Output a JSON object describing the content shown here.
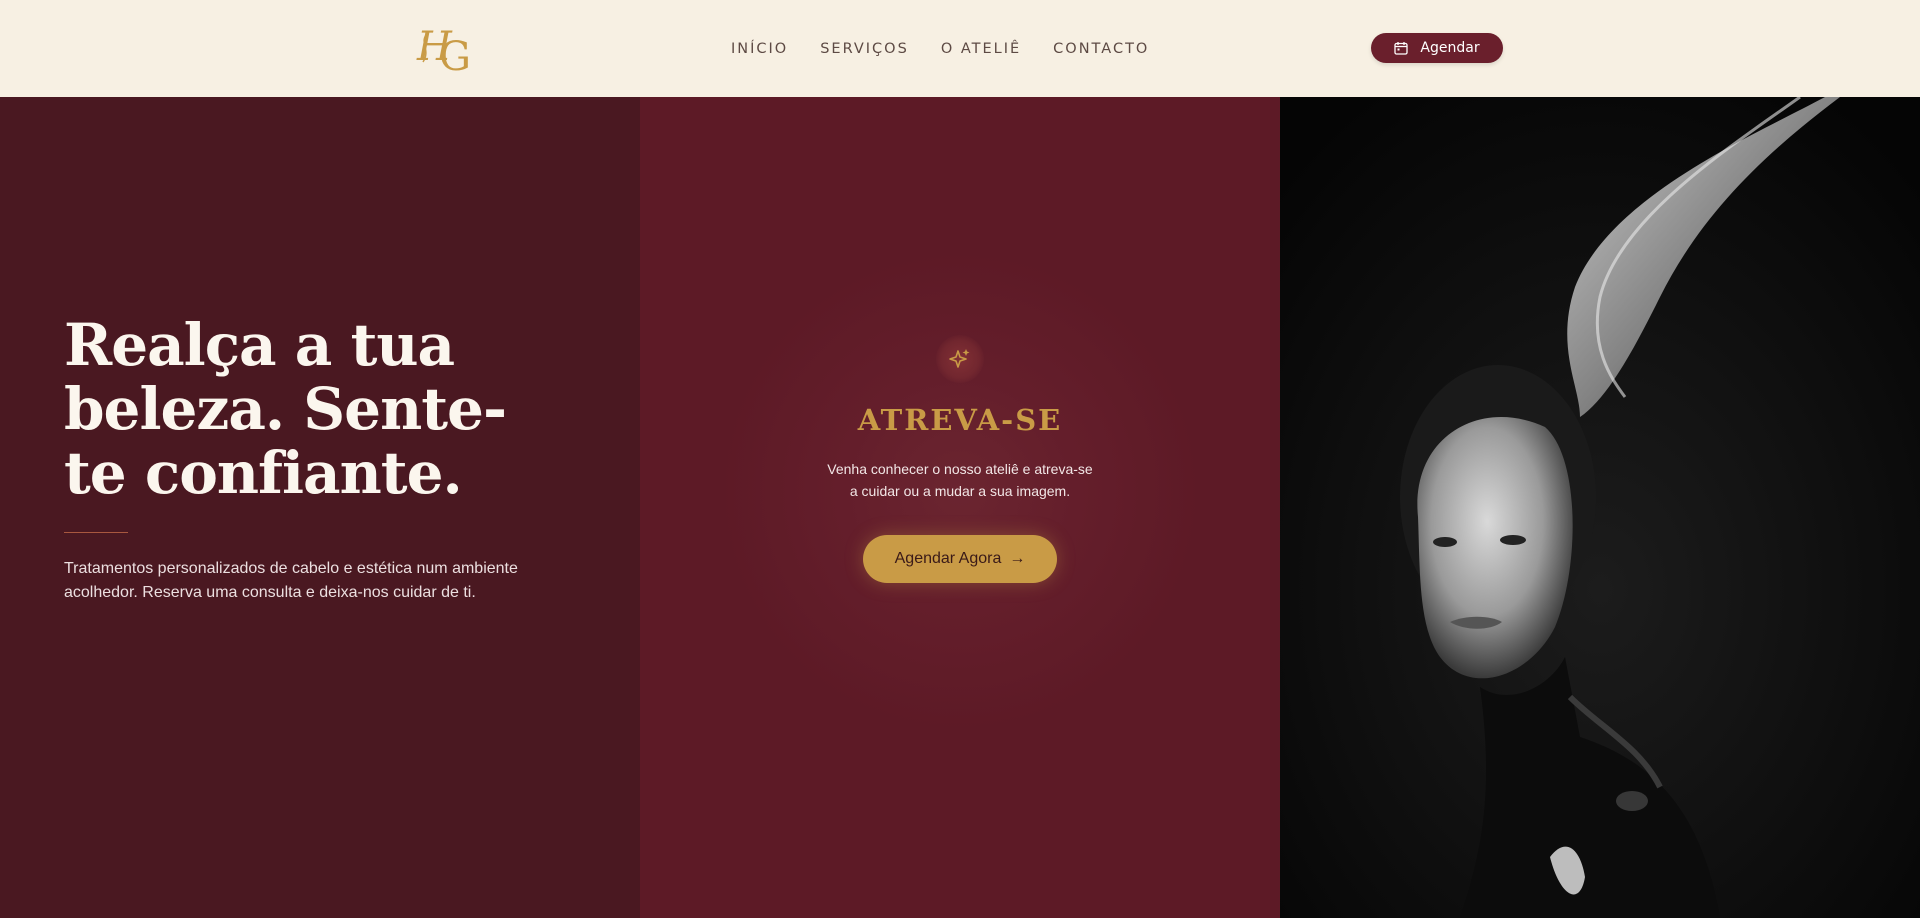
{
  "header": {
    "logo_text": "HG",
    "nav": [
      "INÍCIO",
      "SERVIÇOS",
      "O ATELIÊ",
      "CONTACTO"
    ],
    "book_label": "Agendar",
    "book_icon": "calendar-icon"
  },
  "hero": {
    "title_line1": "Realça a tua",
    "title_line2": "beleza. Sente-",
    "title_line3": "te confiante.",
    "subtitle": "Tratamentos personalizados de cabelo e estética num ambiente acolhedor. Reserva uma consulta e deixa-nos cuidar de ti."
  },
  "promo": {
    "icon": "sparkles-icon",
    "title": "ATREVA-SE",
    "text_line1": "Venha conhecer o nosso ateliê e atreva-se",
    "text_line2": "a cuidar ou a mudar a sua imagem.",
    "cta_label": "Agendar Agora",
    "cta_arrow": "→"
  },
  "colors": {
    "header_bg": "#f7f0e3",
    "panel_left": "#4a1821",
    "panel_mid": "#5d1a26",
    "gold": "#c99b46",
    "burgundy": "#6a1f2c"
  }
}
